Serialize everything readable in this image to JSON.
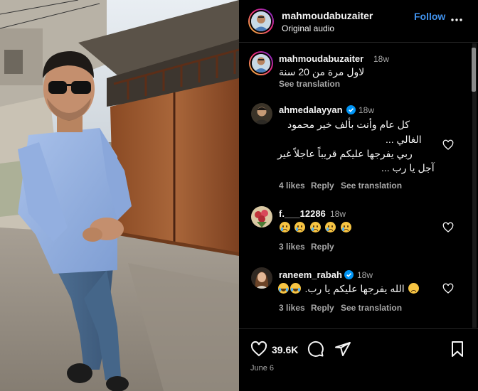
{
  "header": {
    "username": "mahmoudabuzaiter",
    "audio": "Original audio",
    "follow_label": "Follow"
  },
  "comments": [
    {
      "username": "mahmoudabuzaiter",
      "time": "18w",
      "text": [
        "لاول مرة من 20 سنة"
      ],
      "see_translation": "See translation",
      "is_caption": true
    },
    {
      "username": "ahmedalayyan",
      "verified": true,
      "time": "18w",
      "text": [
        "كل عام وأنت بألف خير محمود",
        "الغالي ...",
        "ربي يفرجها عليكم قريباً عاجلاً غير",
        "آجل يا رب ..."
      ],
      "likes": "4 likes",
      "reply": "Reply",
      "see_translation": "See translation"
    },
    {
      "username": "f.___12286",
      "time": "18w",
      "emoji": [
        "sad-crying-face",
        "sad-crying-face",
        "sad-crying-face",
        "sad-crying-face",
        "sad-crying-face"
      ],
      "likes": "3 likes",
      "reply": "Reply"
    },
    {
      "username": "raneem_rabah",
      "verified": true,
      "time": "18w",
      "text": [
        "الله يفرجها عليكم يا رب."
      ],
      "emoji": [
        "crying-laughing-face",
        "crying-laughing-face",
        "pleading-face"
      ],
      "likes": "3 likes",
      "reply": "Reply",
      "see_translation": "See translation"
    }
  ],
  "footer": {
    "like_count": "39.6K",
    "date": "June 6",
    "icons": [
      "heart-icon",
      "comment-icon",
      "share-icon",
      "bookmark-icon"
    ]
  },
  "colors": {
    "background": "#000000",
    "follow": "#4193ef",
    "secondary_text": "#a8a8a8",
    "verified": "#0095f6"
  }
}
